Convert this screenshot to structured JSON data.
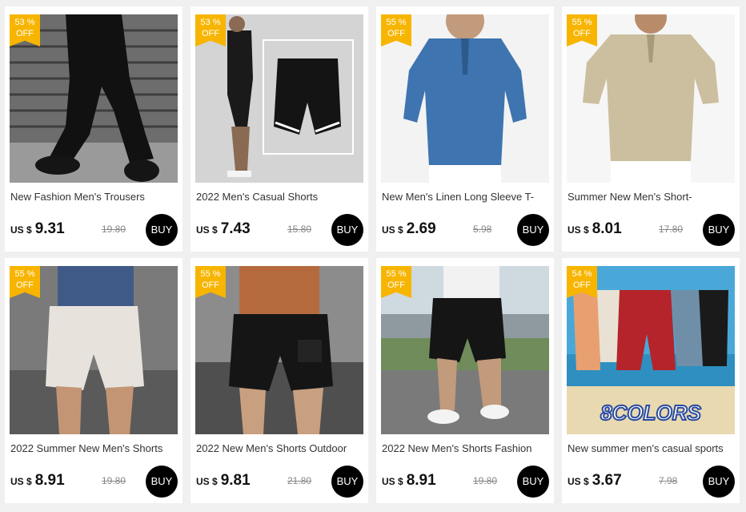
{
  "currency_label": "US $",
  "buy_label": "BUY",
  "badge_off_label": "OFF",
  "products": [
    {
      "discount": "53 %",
      "title": "New Fashion Men's Trousers",
      "price": "9.31",
      "old_price": "19.80",
      "image_subject": "black-trousers"
    },
    {
      "discount": "53 %",
      "title": "2022 Men's Casual Shorts",
      "price": "7.43",
      "old_price": "15.80",
      "image_subject": "black-shorts"
    },
    {
      "discount": "55 %",
      "title": "New Men's Linen Long Sleeve T-",
      "price": "2.69",
      "old_price": "5.98",
      "image_subject": "blue-linen-shirt"
    },
    {
      "discount": "55 %",
      "title": "Summer New Men's Short-",
      "price": "8.01",
      "old_price": "17.80",
      "image_subject": "khaki-shirt"
    },
    {
      "discount": "55 %",
      "title": "2022 Summer New Men's Shorts",
      "price": "8.91",
      "old_price": "19.80",
      "image_subject": "white-shorts"
    },
    {
      "discount": "55 %",
      "title": "2022 New Men's Shorts Outdoor",
      "price": "9.81",
      "old_price": "21.80",
      "image_subject": "black-cargo-shorts"
    },
    {
      "discount": "55 %",
      "title": "2022 New Men's Shorts Fashion",
      "price": "8.91",
      "old_price": "19.80",
      "image_subject": "black-street-shorts"
    },
    {
      "discount": "54 %",
      "title": "New summer men's casual sports",
      "price": "3.67",
      "old_price": "7.98",
      "image_subject": "colorful-shorts",
      "image_text": "8COLORS"
    }
  ]
}
